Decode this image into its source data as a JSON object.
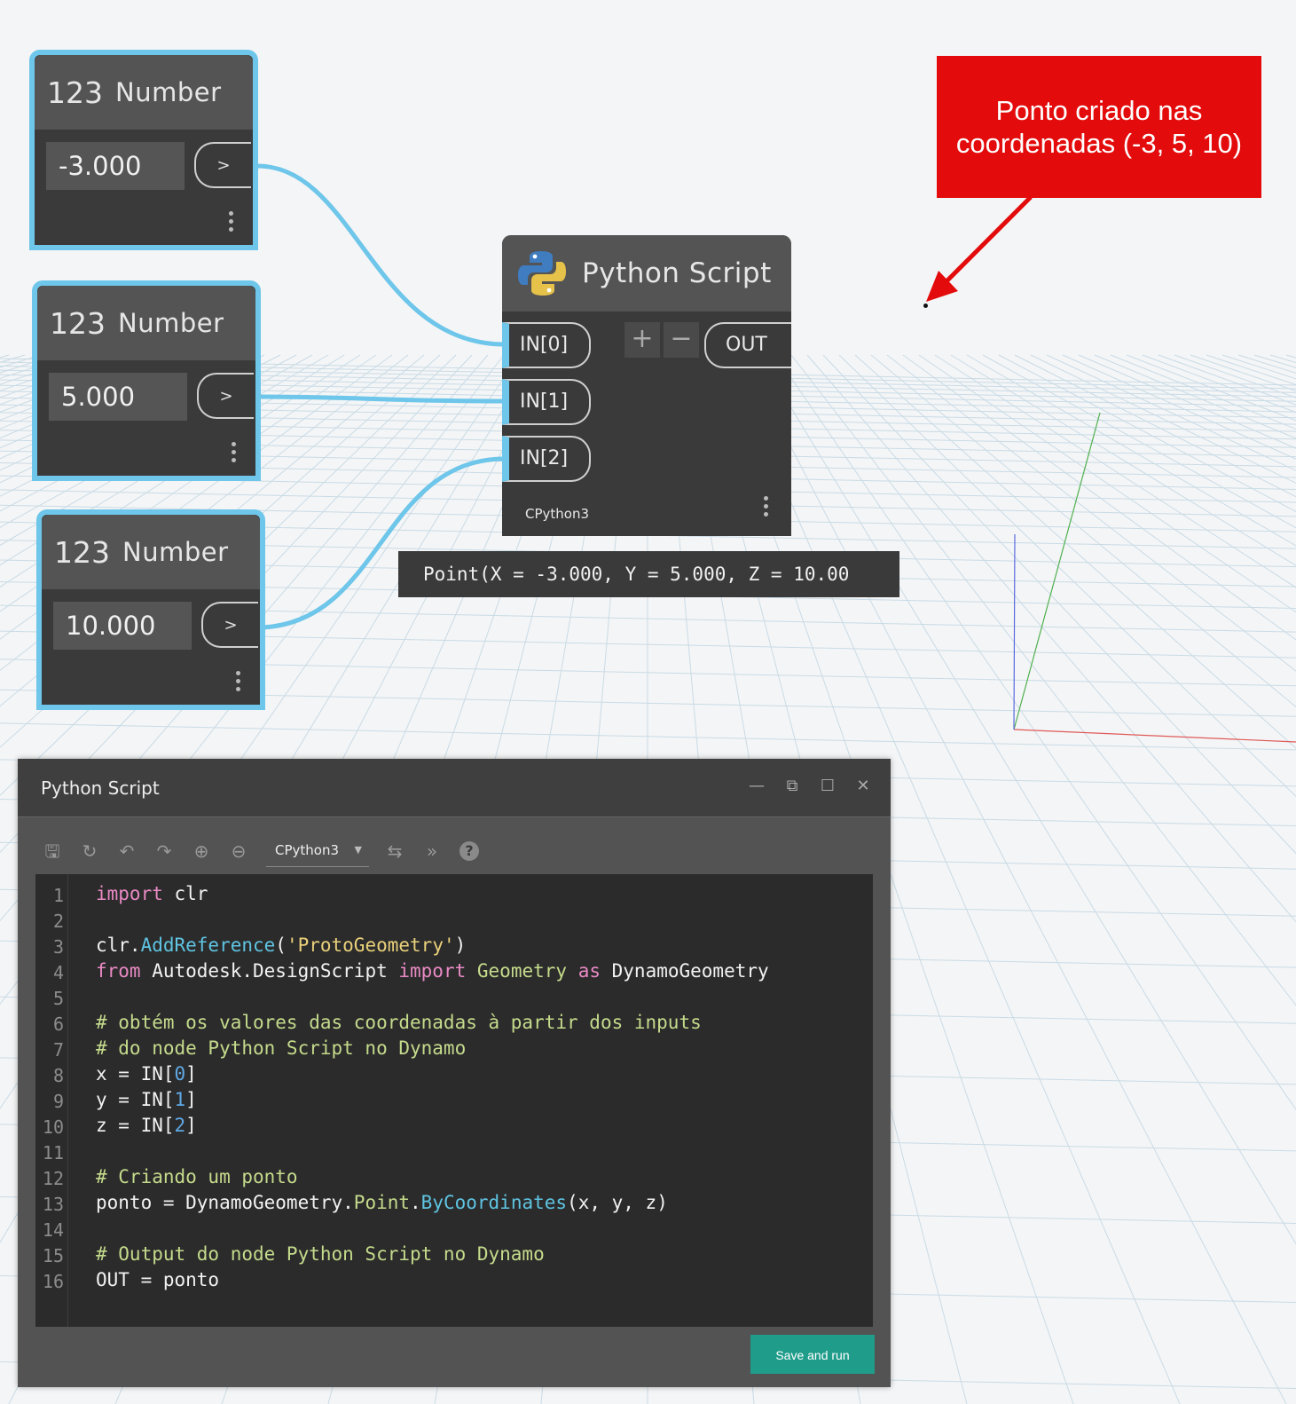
{
  "number_nodes": [
    {
      "icon": "123",
      "title": "Number",
      "value": "-3.000",
      "port": ">"
    },
    {
      "icon": "123",
      "title": "Number",
      "value": "5.000",
      "port": ">"
    },
    {
      "icon": "123",
      "title": "Number",
      "value": "10.000",
      "port": ">"
    }
  ],
  "python_node": {
    "title": "Python Script",
    "inputs": [
      "IN[0]",
      "IN[1]",
      "IN[2]"
    ],
    "add_label": "+",
    "remove_label": "−",
    "output": "OUT",
    "engine": "CPython3"
  },
  "preview": "Point(X = -3.000, Y = 5.000, Z = 10.00",
  "callout": {
    "line1": "Ponto criado nas",
    "line2": "coordenadas (-3, 5, 10)"
  },
  "editor": {
    "title": "Python Script",
    "engine": "CPython3",
    "save_run_label": "Save and run",
    "line_numbers": [
      "1",
      "2",
      "3",
      "4",
      "5",
      "6",
      "7",
      "8",
      "9",
      "10",
      "11",
      "12",
      "13",
      "14",
      "15",
      "16"
    ]
  },
  "colors": {
    "wire": "#6ec6ea",
    "callout": "#e30b0b",
    "save_button": "#1f9c8a"
  }
}
